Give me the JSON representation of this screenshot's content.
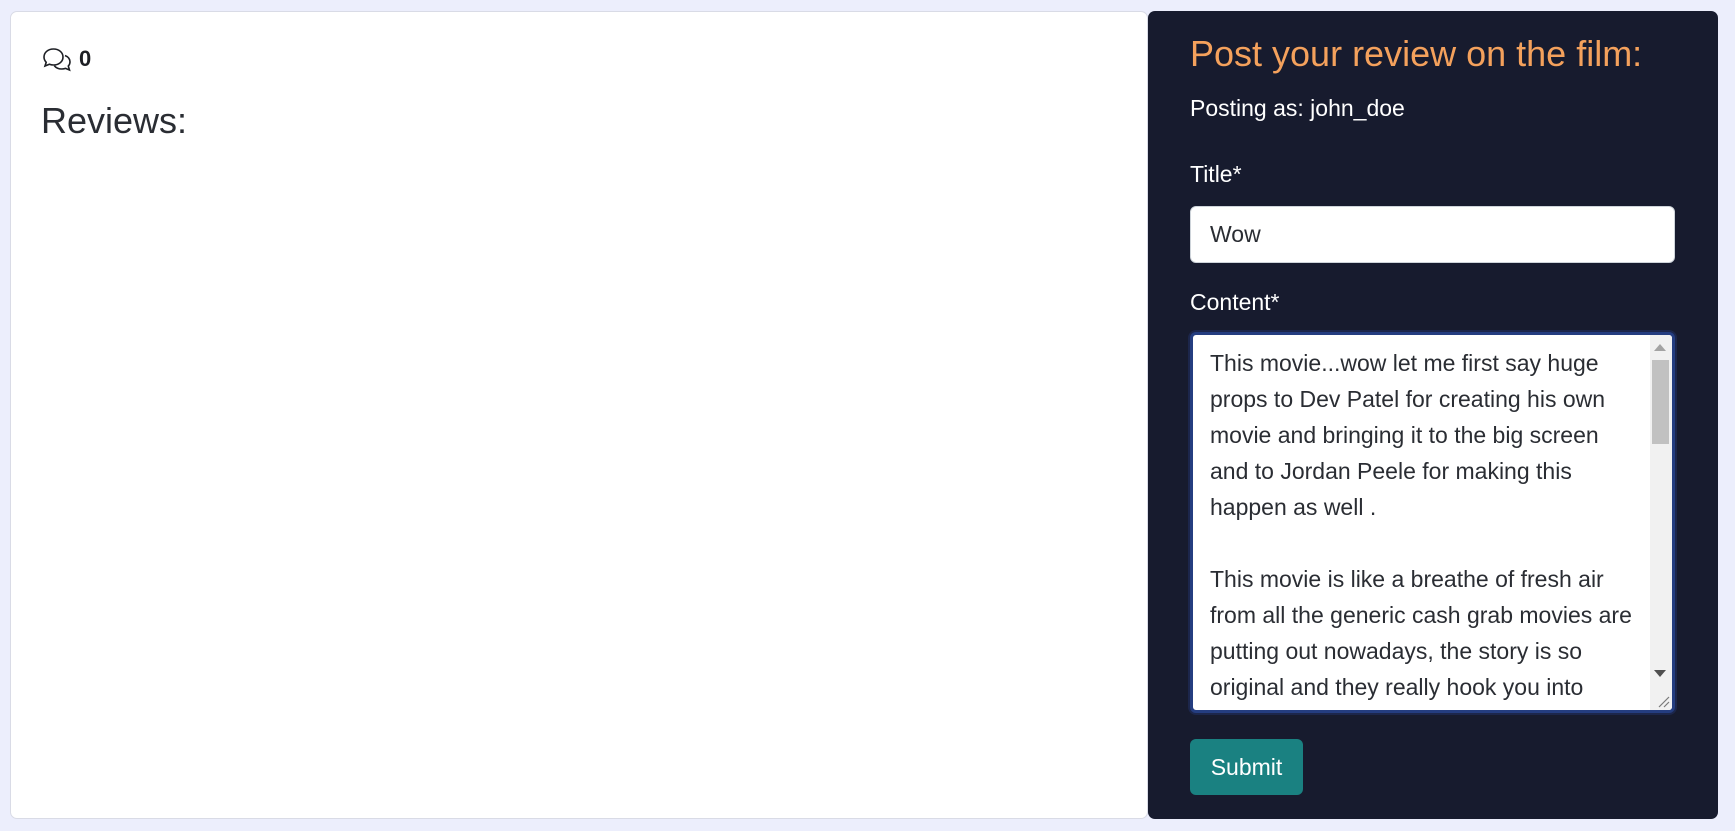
{
  "reviews": {
    "comment_count": "0",
    "heading": "Reviews:",
    "icon": "chat-bubbles-icon"
  },
  "form": {
    "title": "Post your review on the film:",
    "posting_as": "Posting as: john_doe",
    "title_label": "Title*",
    "title_value": "Wow",
    "content_label": "Content*",
    "content_value": "This movie...wow let me first say huge props to Dev Patel for creating his own movie and bringing it to the big screen and to Jordan Peele for making this happen as well .\n\nThis movie is like a breathe of fresh air from all the generic cash grab movies are putting out nowadays, the story is so original and they really hook you into",
    "submit_label": "Submit"
  },
  "colors": {
    "form_bg": "#171b2e",
    "accent": "#f4a15c",
    "submit_bg": "#1a8181",
    "page_bg": "#eceefc"
  }
}
